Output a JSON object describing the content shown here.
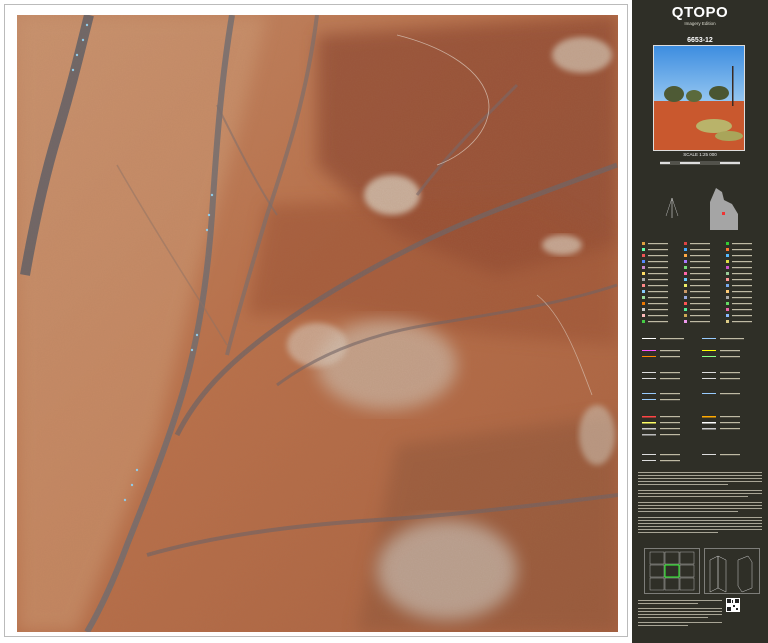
{
  "panel": {
    "title": "QTOPO",
    "edition": "Imagery Edition",
    "sheet_number": "6653-12",
    "scale_label": "SCALE 1:25 000"
  },
  "colors": {
    "panel_bg": "#2f2f27",
    "terrain_base": "#b66a43",
    "terrain_dark": "#8a4630",
    "terrain_light": "#d1a27e",
    "channel": "#6e6a6e",
    "clay_pan": "#d8cfc1",
    "water": "#8fd3f5"
  },
  "icons": {
    "photo": "landscape-photo",
    "state_locator": "queensland-map-icon",
    "north_arrow": "north-arrow-icon",
    "qr": "qr-code-icon",
    "index": "sheet-index-diagram",
    "fold": "fold-diagram-icon"
  }
}
